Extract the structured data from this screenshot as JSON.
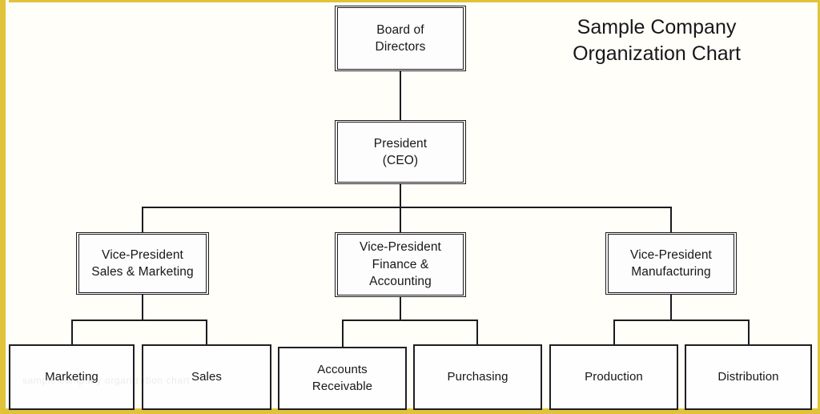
{
  "title": {
    "text": "Sample Company\nOrganization Chart"
  },
  "watermark": {
    "text": "sample company organization chart"
  },
  "colors": {
    "frame": "#e0c33a",
    "line": "#1b1b1f",
    "box_fill": "#fefefe",
    "text": "#17171a",
    "page_background": "#fffef8"
  },
  "nodes": {
    "board": {
      "label": "Board of\nDirectors",
      "level": "top",
      "style": "double"
    },
    "president": {
      "label": "President\n(CEO)",
      "level": "executive",
      "style": "double"
    },
    "vp_sales": {
      "label": "Vice-President\nSales & Marketing",
      "level": "vice-president",
      "style": "double"
    },
    "vp_finance": {
      "label": "Vice-President\nFinance &\nAccounting",
      "level": "vice-president",
      "style": "double"
    },
    "vp_manufacturing": {
      "label": "Vice-President\nManufacturing",
      "level": "vice-president",
      "style": "double"
    },
    "marketing": {
      "label": "Marketing",
      "level": "department",
      "style": "single"
    },
    "sales": {
      "label": "Sales",
      "level": "department",
      "style": "single"
    },
    "accounts_receivable": {
      "label": "Accounts\nReceivable",
      "level": "department",
      "style": "single"
    },
    "purchasing": {
      "label": "Purchasing",
      "level": "department",
      "style": "single"
    },
    "production": {
      "label": "Production",
      "level": "department",
      "style": "single"
    },
    "distribution": {
      "label": "Distribution",
      "level": "department",
      "style": "single"
    }
  },
  "hierarchy": {
    "root": "board",
    "edges": [
      {
        "from": "board",
        "to": "president"
      },
      {
        "from": "president",
        "to": "vp_sales"
      },
      {
        "from": "president",
        "to": "vp_finance"
      },
      {
        "from": "president",
        "to": "vp_manufacturing"
      },
      {
        "from": "vp_sales",
        "to": "marketing"
      },
      {
        "from": "vp_sales",
        "to": "sales"
      },
      {
        "from": "vp_finance",
        "to": "accounts_receivable"
      },
      {
        "from": "vp_finance",
        "to": "purchasing"
      },
      {
        "from": "vp_manufacturing",
        "to": "production"
      },
      {
        "from": "vp_manufacturing",
        "to": "distribution"
      }
    ]
  }
}
